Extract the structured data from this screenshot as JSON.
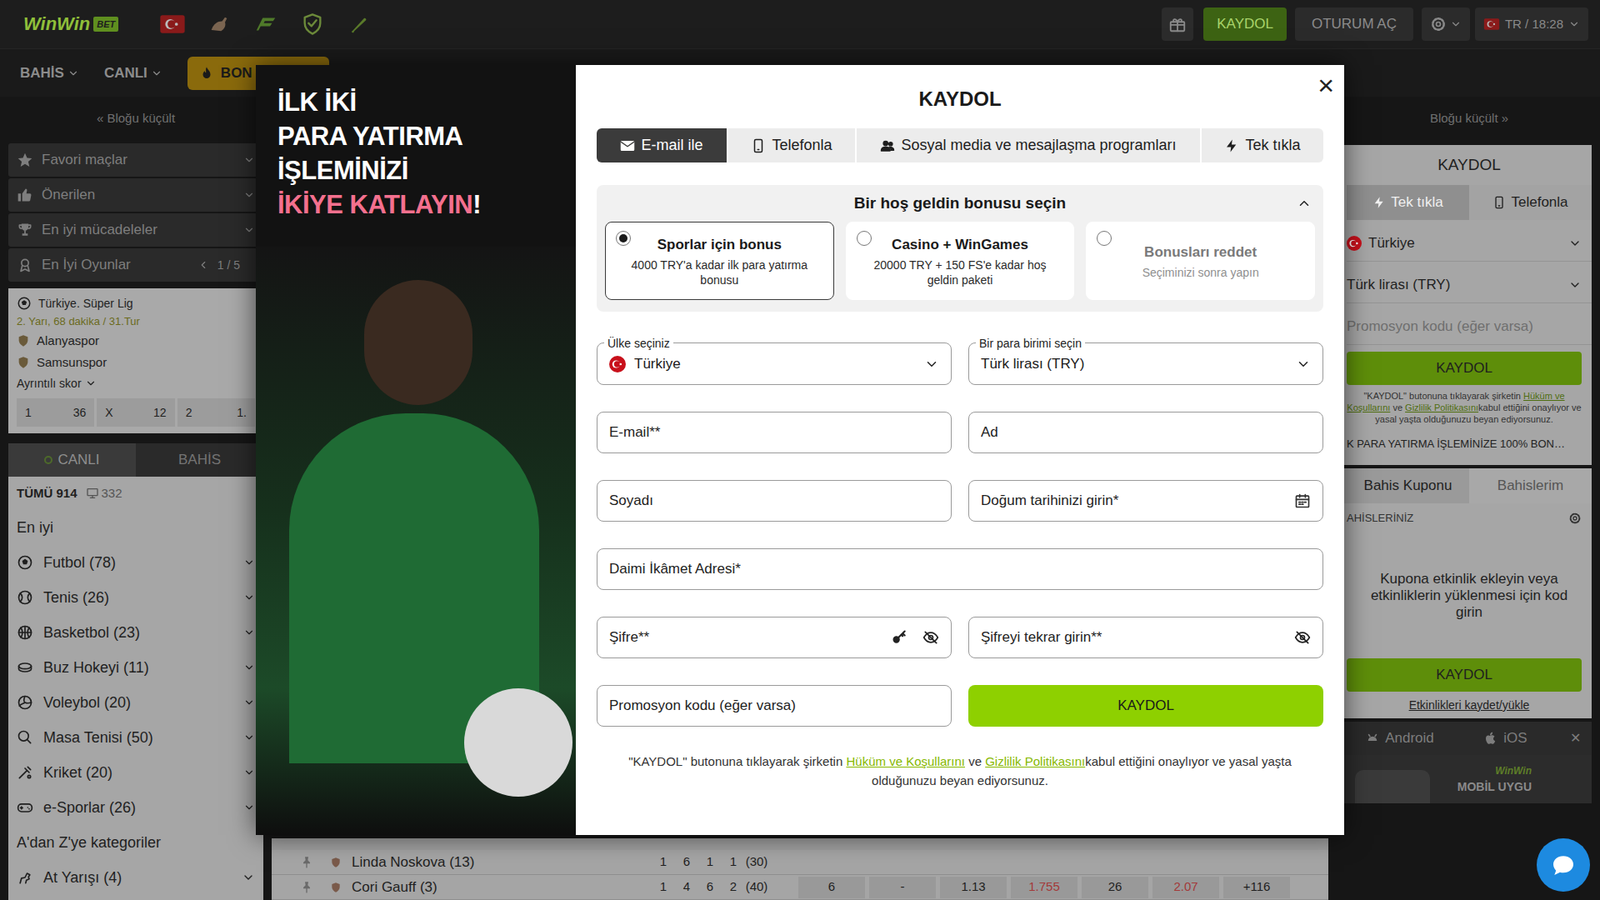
{
  "header": {
    "logo": "WinWin",
    "logo_badge": "BET",
    "register": "KAYDOL",
    "login": "OTURUM AÇ",
    "lang_time": "TR / 18:28"
  },
  "nav": [
    {
      "label": "BAHİS",
      "kind": "menu"
    },
    {
      "label": "CANLI",
      "kind": "menu"
    },
    {
      "label": "BON",
      "kind": "button"
    }
  ],
  "left": {
    "collapse": "« Bloğu küçült",
    "menu": [
      {
        "label": "Favori maçlar"
      },
      {
        "label": "Önerilen"
      },
      {
        "label": "En iyi mücadeleler"
      },
      {
        "label": "En İyi Oyunlar",
        "pager": "1 / 5"
      }
    ],
    "match": {
      "league": "Türkiye. Süper Lig",
      "time": "2. Yarı, 68 dakika / 31.Tur",
      "teams": [
        "Alanyaspor",
        "Samsunspor"
      ],
      "details": "Ayrıntılı skor",
      "odds": [
        {
          "label": "1",
          "value": "36"
        },
        {
          "label": "X",
          "value": "12"
        },
        {
          "label": "2",
          "value": "1."
        }
      ]
    },
    "tabs": [
      {
        "label": "CANLI",
        "selected": true
      },
      {
        "label": "BAHİS",
        "selected": false
      }
    ],
    "all": "TÜMÜ 914",
    "stream_count": "332",
    "best": "En iyi",
    "sports": [
      "Futbol (78)",
      "Tenis (26)",
      "Basketbol (23)",
      "Buz Hokeyi (11)",
      "Voleybol (20)",
      "Masa Tenisi (50)",
      "Kriket (20)",
      "e-Sporlar (26)"
    ],
    "az": "A'dan Z'ye kategoriler",
    "more": [
      "At Yarışı (4)"
    ]
  },
  "center_rows": [
    {
      "name": "Linda Noskova (13)",
      "scores": [
        "1",
        "6",
        "1",
        "1",
        "(30)"
      ],
      "odds": []
    },
    {
      "name": "Cori Gauff (3)",
      "scores": [
        "1",
        "4",
        "6",
        "2",
        "(40)"
      ],
      "odds": [
        {
          "value": "6",
          "color": "#1f1f1f"
        },
        {
          "value": "-",
          "color": "#1f1f1f"
        },
        {
          "value": "1.13",
          "color": "#1f1f1f"
        },
        {
          "value": "1.755",
          "color": "#a33a3a"
        },
        {
          "value": "26",
          "color": "#1f1f1f"
        },
        {
          "value": "2.07",
          "color": "#a33a3a"
        },
        {
          "value": "+116",
          "color": "#1f1f1f"
        }
      ]
    }
  ],
  "modal": {
    "promo_lines": [
      "İLK İKİ",
      "PARA YATIRMA",
      "İŞLEMİNİZİ"
    ],
    "promo_highlight": "İKİYE KATLAYIN",
    "promo_end": "!",
    "close": "×",
    "title": "KAYDOL",
    "tabs": [
      {
        "label": "E-mail ile",
        "selected": true
      },
      {
        "label": "Telefonla",
        "selected": false
      },
      {
        "label": "Sosyal media ve mesajlaşma programları",
        "selected": false
      },
      {
        "label": "Tek tıkla",
        "selected": false
      }
    ],
    "bonus": {
      "title": "Bir hoş geldin bonusu seçin",
      "expanded": true,
      "options": [
        {
          "title": "Sporlar için bonus",
          "desc": "4000 TRY'a kadar ilk para yatırma bonusu",
          "selected": true,
          "disabled": false
        },
        {
          "title": "Casino + WinGames",
          "desc": "20000 TRY + 150 FS'e kadar hoş geldin paketi",
          "selected": false,
          "disabled": false
        },
        {
          "title": "Bonusları reddet",
          "desc": "Seçiminizi sonra yapın",
          "selected": false,
          "disabled": true
        }
      ]
    },
    "country": {
      "label": "Ülke seçiniz",
      "value": "Türkiye"
    },
    "currency": {
      "label": "Bir para birimi seçin",
      "value": "Türk lirası (TRY)"
    },
    "fields": [
      {
        "placeholder": "E-mail**",
        "kind": "text"
      },
      {
        "placeholder": "Ad",
        "kind": "text"
      },
      {
        "placeholder": "Soyadı",
        "kind": "text"
      },
      {
        "placeholder": "Doğum tarihinizi girin*",
        "kind": "date"
      },
      {
        "placeholder": "Daimi İkâmet Adresi*",
        "kind": "wide"
      },
      {
        "placeholder": "Şifre**",
        "kind": "generator"
      },
      {
        "placeholder": "Şifreyi tekrar girin**",
        "kind": "password"
      },
      {
        "placeholder": "Promosyon kodu (eğer varsa)",
        "kind": "text"
      }
    ],
    "submit": "KAYDOL",
    "terms": {
      "before": "\"KAYDOL\" butonuna tıklayarak şirketin ",
      "link1": "Hüküm ve Koşullarını",
      "mid": " ve ",
      "link2": "Gizlilik Politikasını",
      "after": "kabul ettiğini onaylıyor ve yasal yaşta olduğunuzu beyan ediyorsunuz."
    }
  },
  "right": {
    "collapse": "Bloğu küçült »",
    "title": "KAYDOL",
    "tabs": [
      {
        "label": "Tek tıkla",
        "selected": true
      },
      {
        "label": "Telefonla",
        "selected": false
      }
    ],
    "country": "Türkiye",
    "currency": "Türk lirası (TRY)",
    "promo_placeholder": "Promosyon kodu (eğer varsa)",
    "submit": "KAYDOL",
    "terms": {
      "before": "\"KAYDOL\" butonuna tıklayarak şirketin ",
      "link1": "Hüküm ve Koşullarını",
      "mid": " ve ",
      "link2": "Gizlilik Politikasını",
      "after": "kabul ettiğini onaylıyor ve yasal yaşta olduğunuzu beyan ediyorsunuz."
    },
    "banner": "K PARA YATIRMA İŞLEMİNİZE 100% BON…",
    "slip_tabs": [
      {
        "label": "Bahis Kuponu",
        "selected": true
      },
      {
        "label": "Bahislerim",
        "selected": false
      }
    ],
    "slip_header": "AHİSLERİNİZ",
    "slip_empty": "Kupona etkinlik ekleyin veya etkinliklerin yüklenmesi için kod girin",
    "slip_submit": "KAYDOL",
    "save_load": "Etkinlikleri kaydet/yükle",
    "apps": [
      "Android",
      "iOS"
    ],
    "close": "✕",
    "app_logo": "WinWin",
    "app_banner": "MOBİL UYGU"
  }
}
